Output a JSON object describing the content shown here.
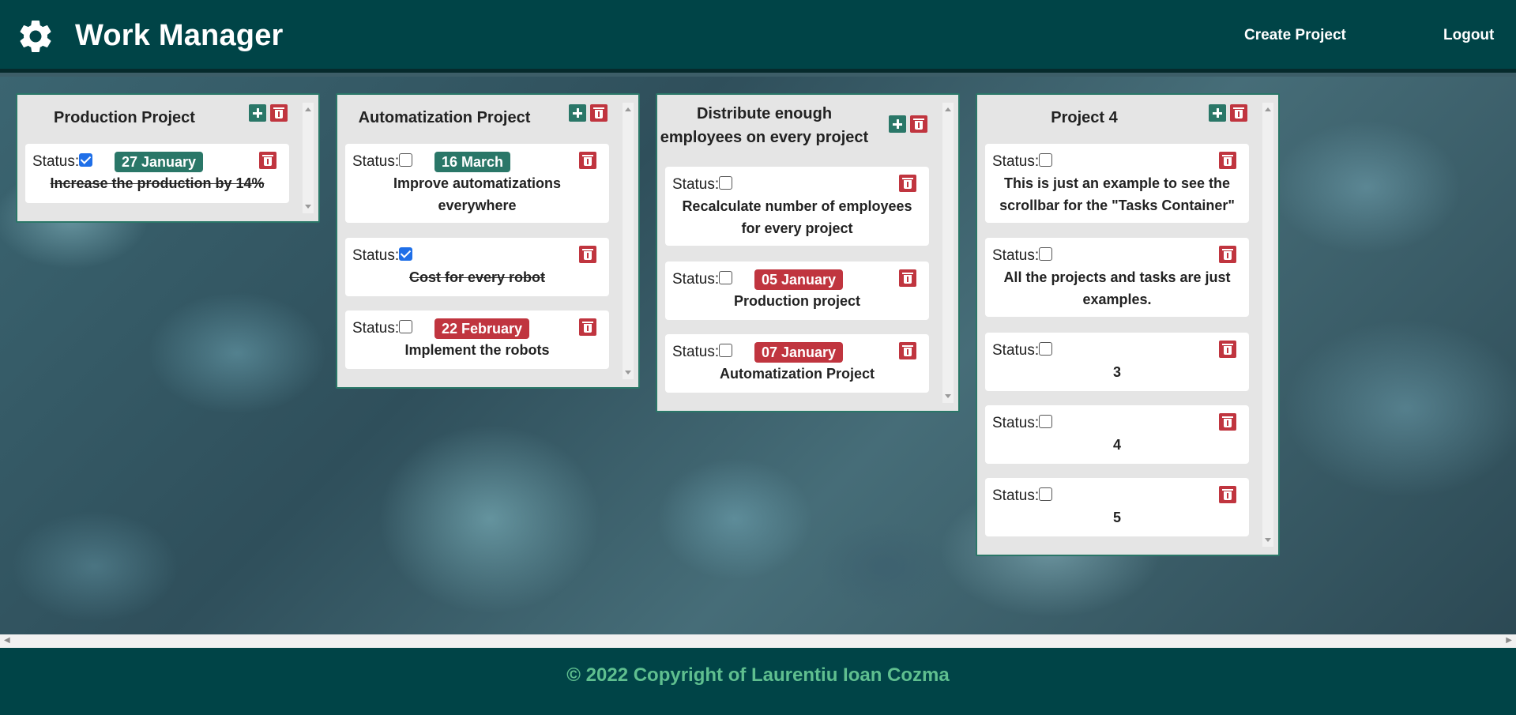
{
  "navbar": {
    "icon": "gear-icon",
    "title": "Work Manager",
    "create_project": "Create Project",
    "logout": "Logout"
  },
  "projects": [
    {
      "title": "Production Project",
      "tasks": [
        {
          "status_label": "Status:",
          "checked": true,
          "date": "27 January",
          "date_color": "green",
          "text": "Increase the production by 14%"
        }
      ]
    },
    {
      "title": "Automatization Project",
      "tasks": [
        {
          "status_label": "Status:",
          "checked": false,
          "date": "16 March",
          "date_color": "green",
          "text": "Improve automatizations everywhere"
        },
        {
          "status_label": "Status:",
          "checked": true,
          "date": "",
          "text": "Cost for every robot"
        },
        {
          "status_label": "Status:",
          "checked": false,
          "date": "22 February",
          "date_color": "red",
          "text": "Implement the robots"
        }
      ]
    },
    {
      "title": "Distribute enough employees on every project",
      "tasks": [
        {
          "status_label": "Status:",
          "checked": false,
          "date": "",
          "text": "Recalculate number of employees for every project"
        },
        {
          "status_label": "Status:",
          "checked": false,
          "date": "05 January",
          "date_color": "red",
          "text": "Production project"
        },
        {
          "status_label": "Status:",
          "checked": false,
          "date": "07 January",
          "date_color": "red",
          "text": "Automatization Project"
        }
      ]
    },
    {
      "title": "Project 4",
      "tasks": [
        {
          "status_label": "Status:",
          "checked": false,
          "date": "",
          "text": "This is just an example to see the scrollbar for the \"Tasks Container\""
        },
        {
          "status_label": "Status:",
          "checked": false,
          "date": "",
          "text": "All the projects and tasks are just examples."
        },
        {
          "status_label": "Status:",
          "checked": false,
          "date": "",
          "text": "3"
        },
        {
          "status_label": "Status:",
          "checked": false,
          "date": "",
          "text": "4"
        },
        {
          "status_label": "Status:",
          "checked": false,
          "date": "",
          "text": "5"
        }
      ]
    }
  ],
  "footer": {
    "text": "© 2022 Copyright of Laurentiu Ioan Cozma"
  },
  "colors": {
    "navbar": "#004447",
    "accent_green": "#2a7768",
    "accent_red": "#c0353f",
    "footer_text": "#5fbf8f"
  }
}
